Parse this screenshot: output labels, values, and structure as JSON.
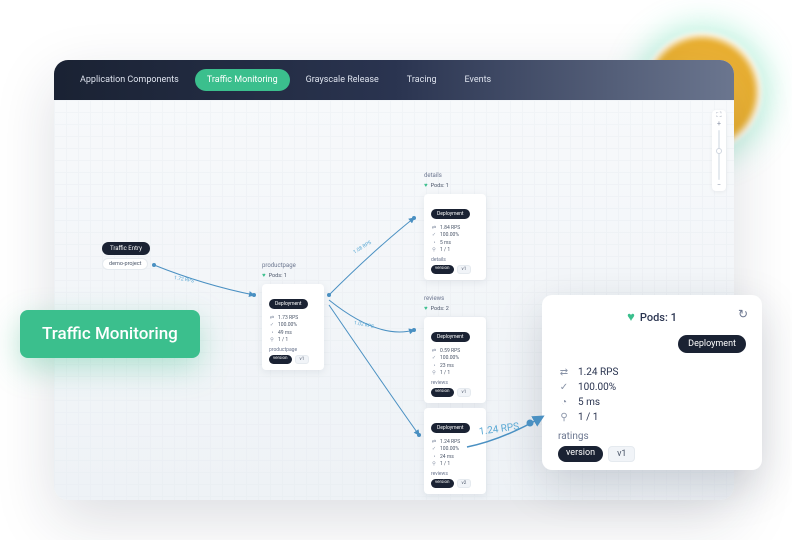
{
  "tabs": [
    "Application Components",
    "Traffic Monitoring",
    "Grayscale Release",
    "Tracing",
    "Events"
  ],
  "activeTab": 1,
  "entry": {
    "label": "Traffic Entry",
    "project": "demo-project"
  },
  "edges": {
    "e1": "1.72 RPS",
    "e2": "1.08 RPS",
    "e3": "1.02 RPS",
    "e4": "1.24 RPS"
  },
  "services": {
    "productpage": {
      "title": "productpage",
      "pods": "Pods: 1",
      "deploy": "Deployment",
      "rps": "1.73 RPS",
      "ok": "100.00%",
      "lat": "49 ms",
      "inst": "1 / 1",
      "sub": "productpage",
      "ver": "version",
      "vval": "v1"
    },
    "details": {
      "title": "details",
      "pods": "Pods: 1",
      "deploy": "Deployment",
      "rps": "1.84 RPS",
      "ok": "100.00%",
      "lat": "5 ms",
      "inst": "1 / 1",
      "sub": "details",
      "ver": "version",
      "vval": "v1"
    },
    "reviews": {
      "title": "reviews",
      "pods": "Pods: 2",
      "deploy": "Deployment",
      "rps": "0.59 RPS",
      "ok": "100.00%",
      "lat": "23 ms",
      "inst": "1 / 1",
      "sub": "reviews",
      "ver": "version",
      "vval": "v1"
    },
    "reviews2": {
      "deploy": "Deployment",
      "rps": "1.24 RPS",
      "ok": "100.00%",
      "lat": "24 ms",
      "inst": "1 / 1",
      "sub": "reviews",
      "ver": "version",
      "vval": "v2"
    }
  },
  "overlayBadge": "Traffic Monitoring",
  "detail": {
    "pods": "Pods: 1",
    "deploy": "Deployment",
    "rps": "1.24 RPS",
    "ok": "100.00%",
    "lat": "5 ms",
    "inst": "1 / 1",
    "sub": "ratings",
    "ver": "version",
    "vval": "v1",
    "edge": "1.24 RPS"
  }
}
